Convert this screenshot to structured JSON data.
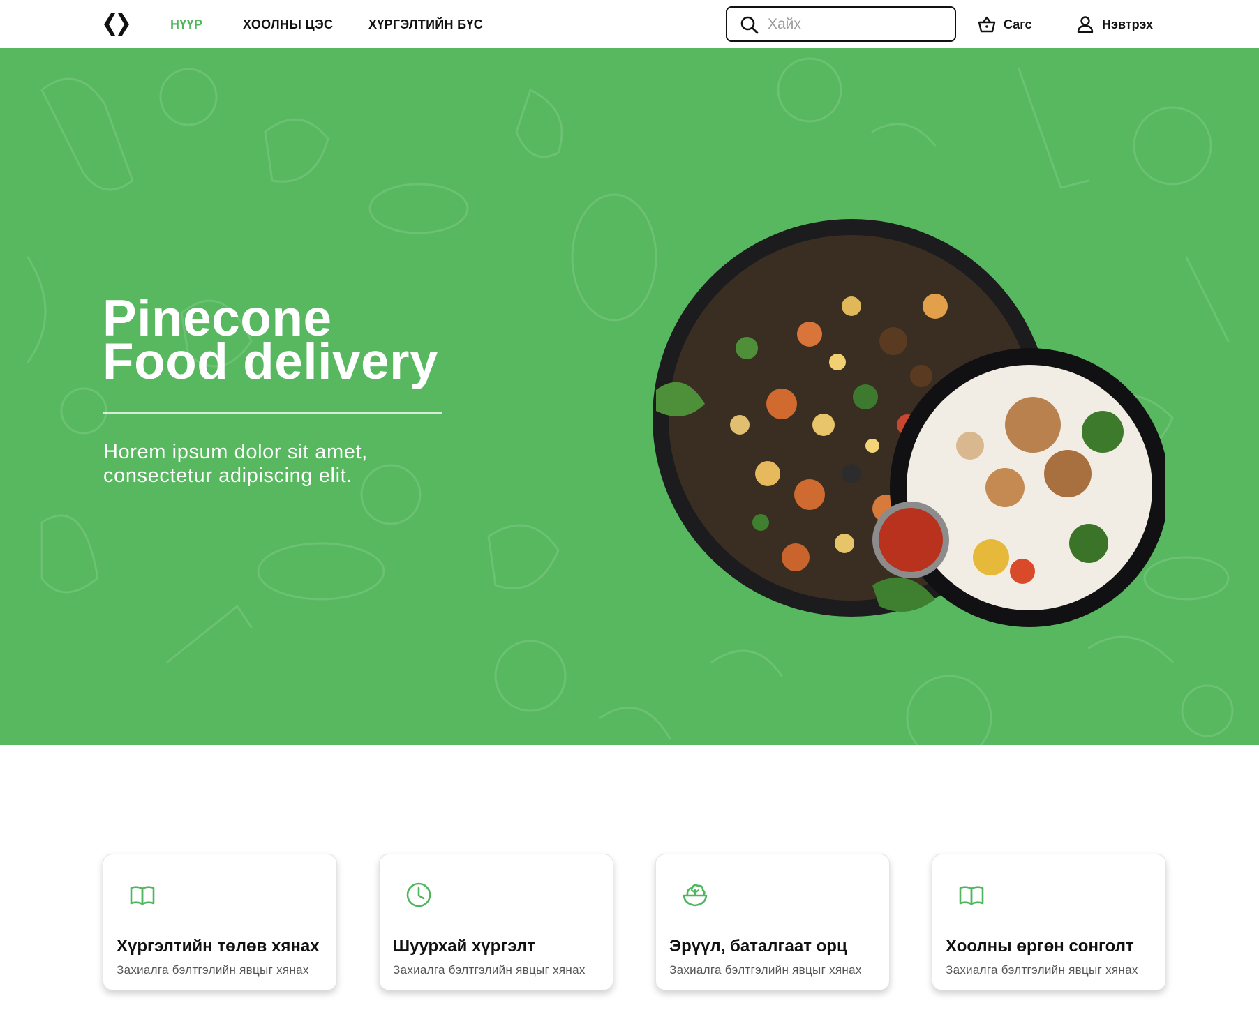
{
  "header": {
    "logo_icon": "braces-logo-icon",
    "nav": [
      {
        "label": "НҮҮР",
        "active": true
      },
      {
        "label": "ХООЛНЫ ЦЭС",
        "active": false
      },
      {
        "label": "ХҮРГЭЛТИЙН БҮС",
        "active": false
      }
    ],
    "search": {
      "placeholder": "Хайх",
      "value": "",
      "icon": "search-icon"
    },
    "cart": {
      "label": "Сагс",
      "icon": "basket-icon"
    },
    "login": {
      "label": "Нэвтрэх",
      "icon": "user-icon"
    }
  },
  "hero": {
    "title_line1": "Pinecone",
    "title_line2": "Food delivery",
    "subtitle_line1": "Horem ipsum dolor sit amet,",
    "subtitle_line2": "consectetur adipiscing elit.",
    "background_color": "#57b85f",
    "accent_color": "#4fb65e"
  },
  "features": [
    {
      "icon": "book-open-icon",
      "title": "Хүргэлтийн төлөв хянах",
      "desc": "Захиалга бэлтгэлийн явцыг хянах"
    },
    {
      "icon": "clock-icon",
      "title": "Шуурхай хүргэлт",
      "desc": "Захиалга бэлтгэлийн явцыг хянах"
    },
    {
      "icon": "salad-bowl-icon",
      "title": "Эрүүл, баталгаат орц",
      "desc": "Захиалга бэлтгэлийн явцыг хянах"
    },
    {
      "icon": "book-open-icon",
      "title": "Хоолны өргөн сонголт",
      "desc": "Захиалга бэлтгэлийн явцыг хянах"
    }
  ]
}
